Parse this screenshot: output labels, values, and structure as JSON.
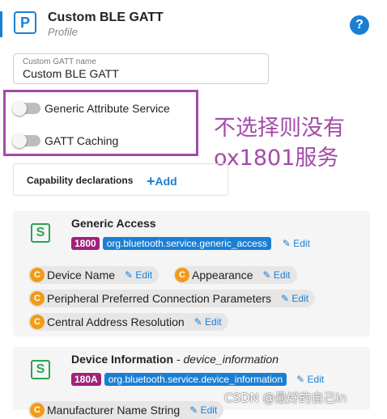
{
  "profile": {
    "icon_letter": "P",
    "title": "Custom BLE GATT",
    "subtitle": "Profile",
    "help_glyph": "?"
  },
  "gatt_name_field": {
    "label": "Custom GATT name",
    "value": "Custom BLE GATT"
  },
  "toggles": [
    {
      "label": "Generic Attribute Service",
      "on": false
    },
    {
      "label": "GATT Caching",
      "on": false
    }
  ],
  "annotation": {
    "line1": "不选择则没有",
    "line2": "ox1801服务",
    "color": "#a34ba8"
  },
  "capabilities": {
    "label": "Capability declarations",
    "add_label": "Add"
  },
  "services": [
    {
      "icon_letter": "S",
      "name": "Generic Access",
      "alias": "",
      "uuid": "1800",
      "type_id": "org.bluetooth.service.generic_access",
      "edit_label": "Edit",
      "characteristics": [
        {
          "badge": "C",
          "name": "Device Name",
          "edit_label": "Edit"
        },
        {
          "badge": "C",
          "name": "Appearance",
          "edit_label": "Edit"
        },
        {
          "badge": "C",
          "name": "Peripheral Preferred Connection Parameters",
          "edit_label": "Edit"
        },
        {
          "badge": "C",
          "name": "Central Address Resolution",
          "edit_label": "Edit"
        }
      ]
    },
    {
      "icon_letter": "S",
      "name": "Device Information",
      "alias": " - device_information",
      "uuid": "180A",
      "type_id": "org.bluetooth.service.device_information",
      "edit_label": "Edit",
      "characteristics": [
        {
          "badge": "C",
          "name": "Manufacturer Name String",
          "edit_label": "Edit"
        }
      ]
    }
  ],
  "watermark": "CSDN @最好的自己in",
  "colors": {
    "primary": "#1a7fd4",
    "service_green": "#2ea44f",
    "uuid_badge": "#a0237a",
    "characteristic_orange": "#f29b16",
    "annotation_purple": "#a34ba8"
  }
}
